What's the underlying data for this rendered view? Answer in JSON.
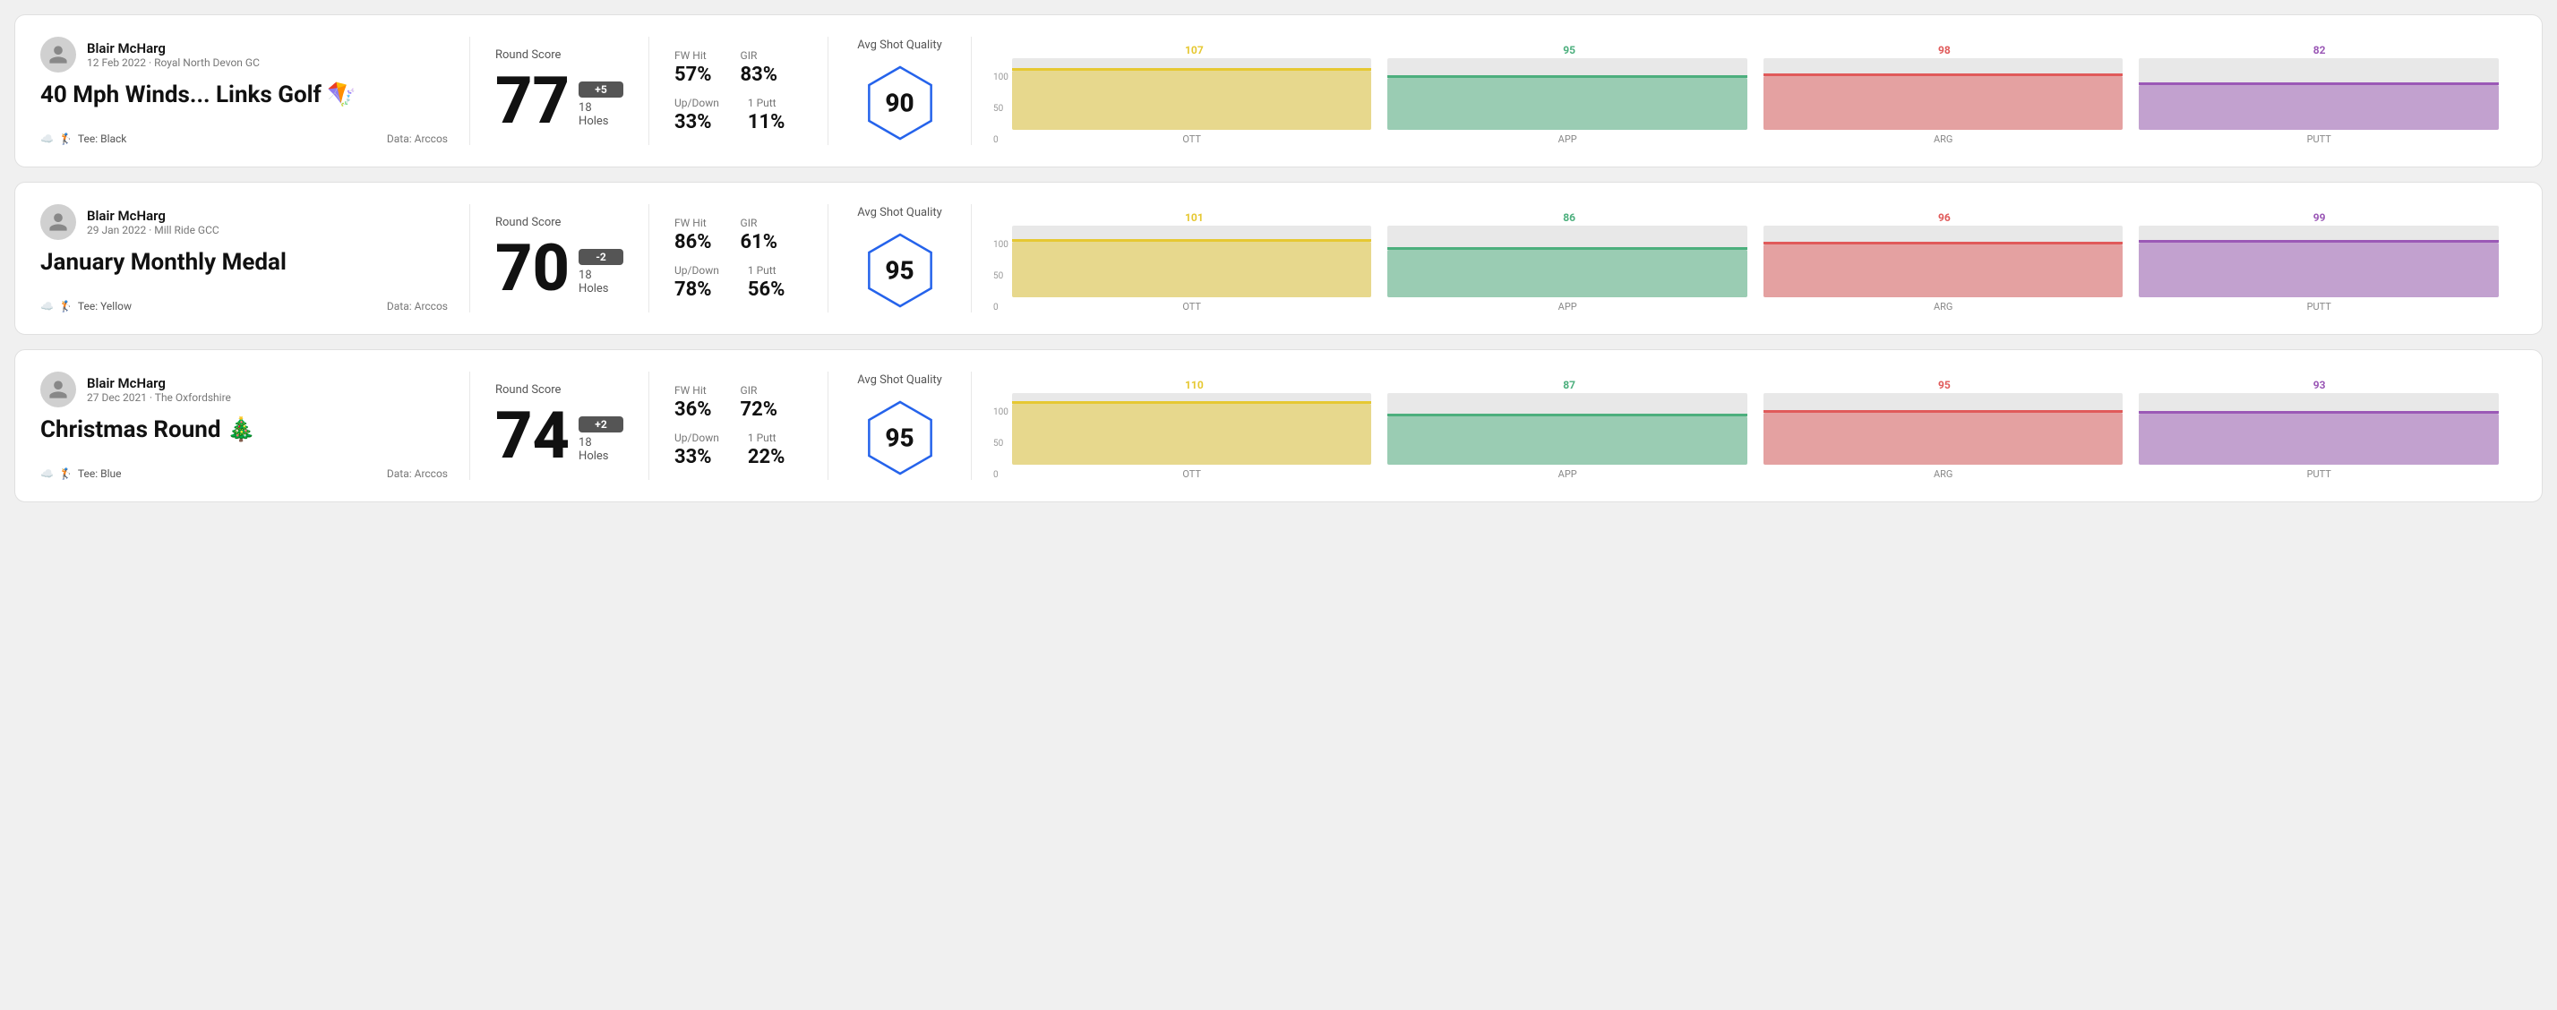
{
  "rounds": [
    {
      "id": "round1",
      "user": {
        "name": "Blair McHarg",
        "meta": "12 Feb 2022 · Royal North Devon GC"
      },
      "title": "40 Mph Winds... Links Golf 🪁",
      "tee": "Black",
      "data_source": "Data: Arccos",
      "score": {
        "label": "Round Score",
        "number": "77",
        "badge": "+5",
        "badge_type": "positive",
        "holes": "18 Holes"
      },
      "stats": {
        "fw_hit_label": "FW Hit",
        "fw_hit_value": "57%",
        "gir_label": "GIR",
        "gir_value": "83%",
        "updown_label": "Up/Down",
        "updown_value": "33%",
        "oneputt_label": "1 Putt",
        "oneputt_value": "11%"
      },
      "avg_shot_quality": {
        "label": "Avg Shot Quality",
        "score": "90"
      },
      "chart": {
        "bars": [
          {
            "label": "OTT",
            "value": 107,
            "color": "#e6c832",
            "max": 130
          },
          {
            "label": "APP",
            "value": 95,
            "color": "#4caf7d",
            "max": 130
          },
          {
            "label": "ARG",
            "value": 98,
            "color": "#e05a5a",
            "max": 130
          },
          {
            "label": "PUTT",
            "value": 82,
            "color": "#9b59b6",
            "max": 130
          }
        ],
        "y_labels": [
          "100",
          "50",
          "0"
        ]
      }
    },
    {
      "id": "round2",
      "user": {
        "name": "Blair McHarg",
        "meta": "29 Jan 2022 · Mill Ride GCC"
      },
      "title": "January Monthly Medal",
      "tee": "Yellow",
      "data_source": "Data: Arccos",
      "score": {
        "label": "Round Score",
        "number": "70",
        "badge": "-2",
        "badge_type": "negative",
        "holes": "18 Holes"
      },
      "stats": {
        "fw_hit_label": "FW Hit",
        "fw_hit_value": "86%",
        "gir_label": "GIR",
        "gir_value": "61%",
        "updown_label": "Up/Down",
        "updown_value": "78%",
        "oneputt_label": "1 Putt",
        "oneputt_value": "56%"
      },
      "avg_shot_quality": {
        "label": "Avg Shot Quality",
        "score": "95"
      },
      "chart": {
        "bars": [
          {
            "label": "OTT",
            "value": 101,
            "color": "#e6c832",
            "max": 130
          },
          {
            "label": "APP",
            "value": 86,
            "color": "#4caf7d",
            "max": 130
          },
          {
            "label": "ARG",
            "value": 96,
            "color": "#e05a5a",
            "max": 130
          },
          {
            "label": "PUTT",
            "value": 99,
            "color": "#9b59b6",
            "max": 130
          }
        ],
        "y_labels": [
          "100",
          "50",
          "0"
        ]
      }
    },
    {
      "id": "round3",
      "user": {
        "name": "Blair McHarg",
        "meta": "27 Dec 2021 · The Oxfordshire"
      },
      "title": "Christmas Round 🎄",
      "tee": "Blue",
      "data_source": "Data: Arccos",
      "score": {
        "label": "Round Score",
        "number": "74",
        "badge": "+2",
        "badge_type": "positive",
        "holes": "18 Holes"
      },
      "stats": {
        "fw_hit_label": "FW Hit",
        "fw_hit_value": "36%",
        "gir_label": "GIR",
        "gir_value": "72%",
        "updown_label": "Up/Down",
        "updown_value": "33%",
        "oneputt_label": "1 Putt",
        "oneputt_value": "22%"
      },
      "avg_shot_quality": {
        "label": "Avg Shot Quality",
        "score": "95"
      },
      "chart": {
        "bars": [
          {
            "label": "OTT",
            "value": 110,
            "color": "#e6c832",
            "max": 130
          },
          {
            "label": "APP",
            "value": 87,
            "color": "#4caf7d",
            "max": 130
          },
          {
            "label": "ARG",
            "value": 95,
            "color": "#e05a5a",
            "max": 130
          },
          {
            "label": "PUTT",
            "value": 93,
            "color": "#9b59b6",
            "max": 130
          }
        ],
        "y_labels": [
          "100",
          "50",
          "0"
        ]
      }
    }
  ]
}
